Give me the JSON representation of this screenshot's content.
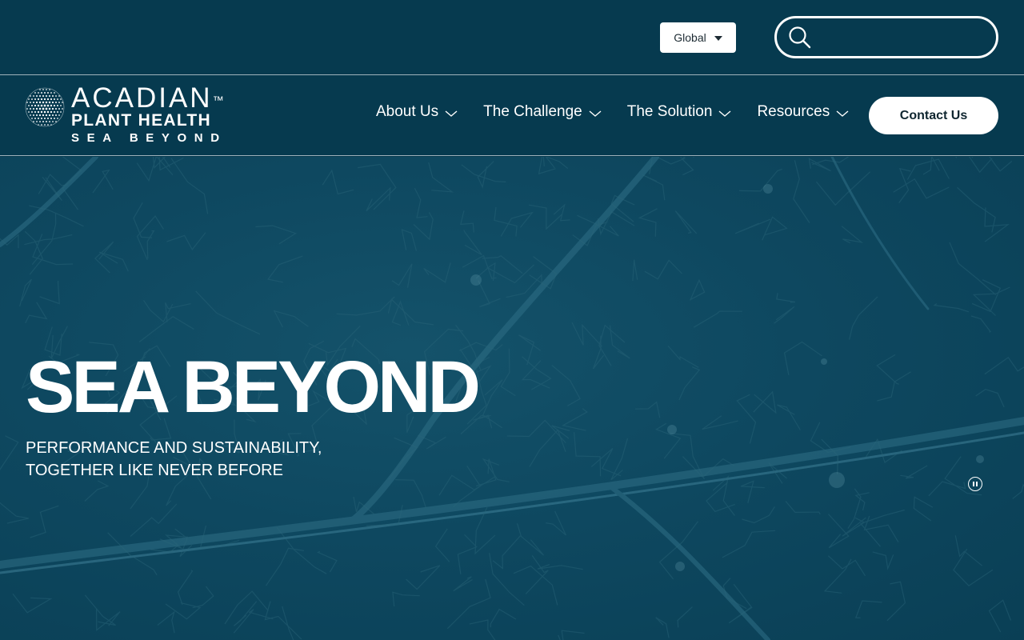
{
  "utility_bar": {
    "region_label": "Global",
    "search_placeholder": ""
  },
  "brand": {
    "name": "ACADIAN",
    "trademark": "™",
    "subtitle": "PLANT HEALTH",
    "tagline": "SEA BEYOND"
  },
  "nav": {
    "items": [
      {
        "label": "About Us",
        "icon": "chevron-down-icon"
      },
      {
        "label": "The Challenge",
        "icon": "chevron-down-icon"
      },
      {
        "label": "The Solution",
        "icon": "chevron-down-icon"
      },
      {
        "label": "Resources",
        "icon": "chevron-down-icon"
      }
    ],
    "contact_label": "Contact Us"
  },
  "hero": {
    "title": "SEA BEYOND",
    "subtitle_line1": "PERFORMANCE AND SUSTAINABILITY,",
    "subtitle_line2": "TOGETHER LIKE NEVER BEFORE",
    "pause_icon": "pause-icon"
  },
  "colors": {
    "background": "#063a4f",
    "hero_background": "#0e4860",
    "button_background": "#ffffff",
    "text": "#ffffff"
  }
}
